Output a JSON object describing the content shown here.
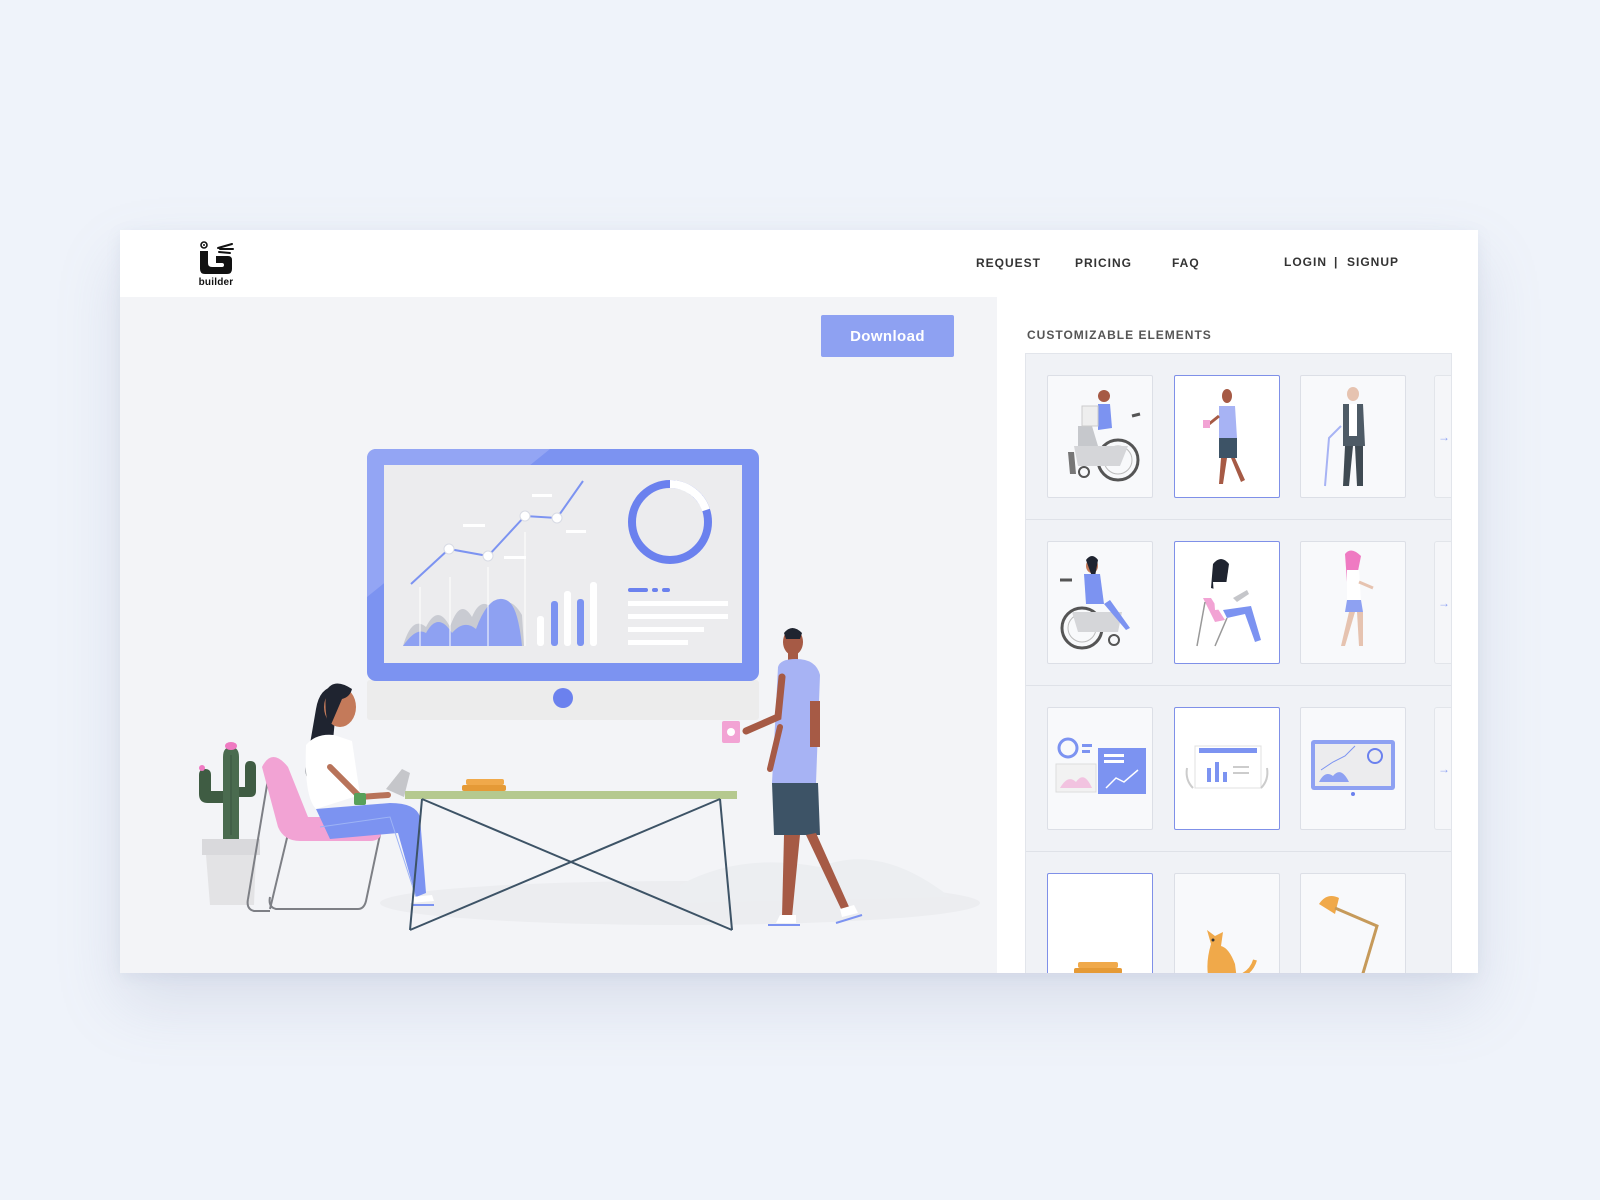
{
  "header": {
    "logo_text": "builder",
    "nav": [
      "REQUEST",
      "PRICING",
      "FAQ"
    ],
    "auth": {
      "login": "LOGIN",
      "separator": "|",
      "signup": "SIGNUP"
    }
  },
  "canvas": {
    "download_label": "Download"
  },
  "panel": {
    "title": "CUSTOMIZABLE ELEMENTS",
    "rows": [
      {
        "items": [
          {
            "icon": "man-wheelchair-laptop-icon",
            "selected": false
          },
          {
            "icon": "man-holding-cup-icon",
            "selected": true
          },
          {
            "icon": "elderly-man-cane-icon",
            "selected": false
          }
        ],
        "has_next_arrow": true
      },
      {
        "items": [
          {
            "icon": "woman-wheelchair-icon",
            "selected": false
          },
          {
            "icon": "woman-chair-laptop-icon",
            "selected": true
          },
          {
            "icon": "woman-walking-icon",
            "selected": false
          }
        ],
        "has_next_arrow": true
      },
      {
        "items": [
          {
            "icon": "dashboard-widgets-icon",
            "selected": false
          },
          {
            "icon": "bar-chart-board-icon",
            "selected": true
          },
          {
            "icon": "monitor-chart-icon",
            "selected": false
          }
        ],
        "has_next_arrow": true
      },
      {
        "items": [
          {
            "icon": "books-icon",
            "selected": true
          },
          {
            "icon": "cat-icon",
            "selected": false
          },
          {
            "icon": "desk-lamp-icon",
            "selected": false
          }
        ],
        "has_next_arrow": false
      }
    ],
    "next_arrow_glyph": "→"
  },
  "colors": {
    "accent": "#8ea1f2",
    "accent_dark": "#6b81ee",
    "pink": "#f2a3d4",
    "cactus": "#4a6b4f",
    "table_top": "#b5c98f",
    "skin_dark": "#a65a45",
    "background": "#eff3fa"
  }
}
